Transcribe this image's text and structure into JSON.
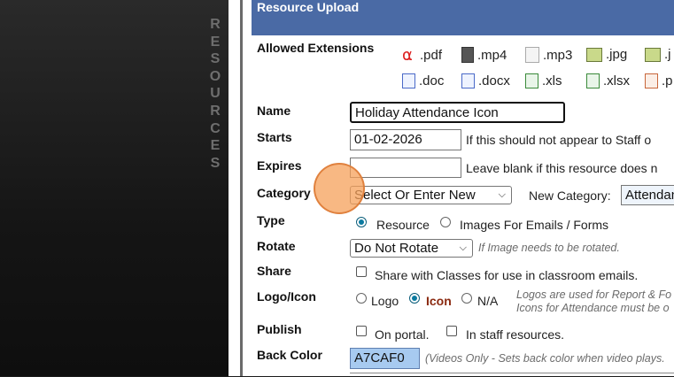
{
  "sidebar": {
    "vertical_word": [
      "R",
      "E",
      "S",
      "O",
      "U",
      "R",
      "C",
      "E",
      "S"
    ]
  },
  "header": {
    "title": "Resource Upload"
  },
  "allowed": {
    "label": "Allowed Extensions",
    "row1": [
      ".pdf",
      ".mp4",
      ".mp3",
      ".jpg",
      ".j"
    ],
    "row2": [
      ".doc",
      ".docx",
      ".xls",
      ".xlsx",
      ".p"
    ]
  },
  "name": {
    "label": "Name",
    "value": "Holiday Attendance Icon"
  },
  "starts": {
    "label": "Starts",
    "value": "01-02-2026",
    "hint": "If this should not appear to Staff o"
  },
  "expires": {
    "label": "Expires",
    "value": "",
    "hint": "Leave blank if this resource does n"
  },
  "category": {
    "label": "Category",
    "selected": "Select Or Enter New",
    "new_label": "New Category:",
    "new_value": "Attendan"
  },
  "type": {
    "label": "Type",
    "options": [
      "Resource",
      "Images For Emails / Forms"
    ],
    "selected": "Resource"
  },
  "rotate": {
    "label": "Rotate",
    "selected": "Do Not Rotate",
    "hint": "If Image needs to be rotated."
  },
  "share": {
    "label": "Share",
    "checkbox_label": "Share with Classes for use in classroom emails.",
    "checked": false
  },
  "logo_icon": {
    "label": "Logo/Icon",
    "options": [
      "Logo",
      "Icon",
      "N/A"
    ],
    "selected": "Icon",
    "hint_line1": "Logos are used for Report & Fo",
    "hint_line2": "Icons for Attendance must be o"
  },
  "publish": {
    "label": "Publish",
    "on_portal": "On portal.",
    "staff_resources": "In staff resources."
  },
  "back_color": {
    "label": "Back Color",
    "value": "A7CAF0",
    "hint": "(Videos Only - Sets back color when video plays.",
    "color": "#A7CAF0"
  }
}
